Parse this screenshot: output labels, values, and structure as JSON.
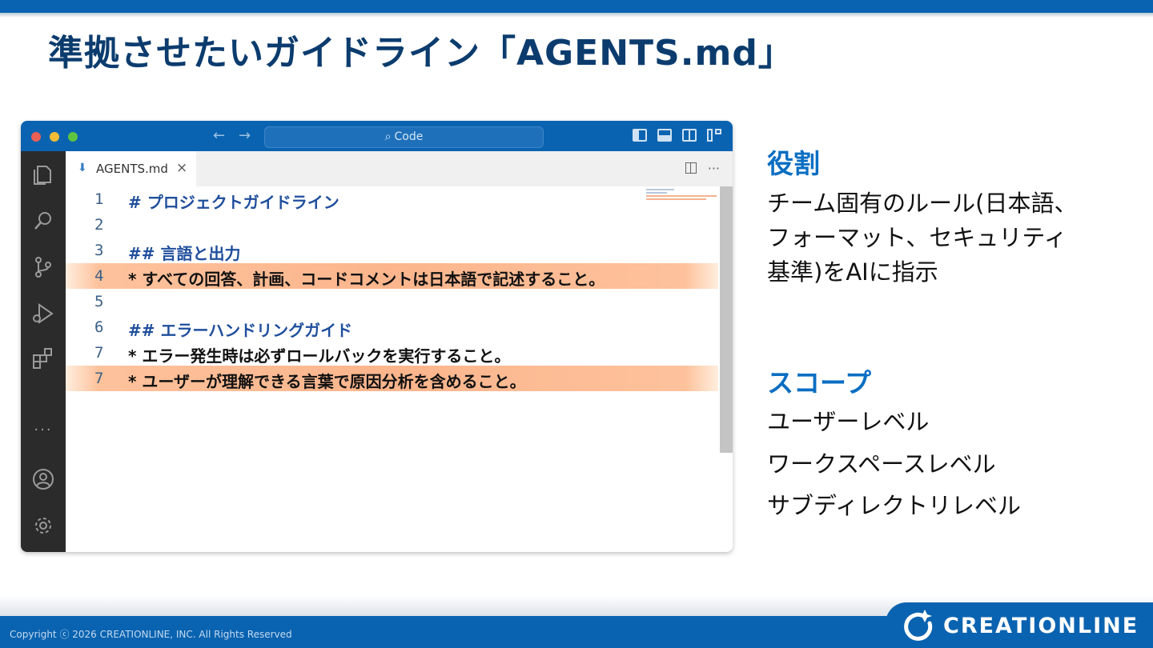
{
  "slide": {
    "title": "準拠させたいガイドライン「AGENTS.md」"
  },
  "editor_window": {
    "command_center": "Code",
    "tab": {
      "label": "AGENTS.md",
      "close": "×",
      "more": "···"
    },
    "lines": [
      {
        "num": "1",
        "text": "# プロジェクトガイドライン",
        "kind": "heading",
        "highlighted": false
      },
      {
        "num": "2",
        "text": "",
        "kind": "blank",
        "highlighted": false
      },
      {
        "num": "3",
        "text": "## 言語と出力",
        "kind": "heading",
        "highlighted": false
      },
      {
        "num": "4",
        "text": "* すべての回答、計画、コードコメントは日本語で記述すること。",
        "kind": "bullet",
        "highlighted": true
      },
      {
        "num": "5",
        "text": "",
        "kind": "blank",
        "highlighted": false
      },
      {
        "num": "6",
        "text": "## エラーハンドリングガイド",
        "kind": "heading",
        "highlighted": false
      },
      {
        "num": "7",
        "text": "* エラー発生時は必ずロールバックを実行すること。",
        "kind": "bullet",
        "highlighted": false
      },
      {
        "num": "7",
        "text": "* ユーザーが理解できる言葉で原因分析を含めること。",
        "kind": "bullet",
        "highlighted": true
      }
    ],
    "highlight_color": "#fcb58c",
    "activity_icons": [
      "explorer-icon",
      "search-icon",
      "source-control-icon",
      "run-debug-icon",
      "extensions-icon",
      "more-icon",
      "account-icon",
      "settings-gear-icon"
    ]
  },
  "right_panel": {
    "role_heading": "役割",
    "role_lines": [
      "チーム固有のルール(日本語、",
      "フォーマット、セキュリティ",
      "基準)をAIに指示"
    ],
    "scope_heading": "スコープ",
    "scope_items": [
      "ユーザーレベル",
      "ワークスペースレベル",
      "サブディレクトリレベル"
    ]
  },
  "footer": {
    "copyright": "Copyright ⓒ 2026 CREATIONLINE, INC. All Rights Reserved",
    "logo_text": "CREATIONLINE"
  },
  "colors": {
    "brand_blue": "#0a63b0",
    "title_navy": "#0c3c6e",
    "accent_blue": "#0a6ec2"
  }
}
